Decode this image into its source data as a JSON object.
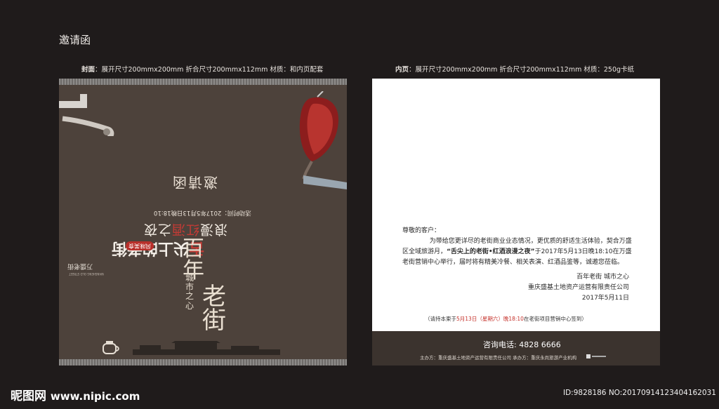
{
  "page_title": "邀请函",
  "cover_spec": {
    "label": "封面",
    "text": "：展开尺寸200mmx200mm 折合尺寸200mmx112mm 材质：和内页配套"
  },
  "inner_spec": {
    "label": "内页",
    "text": "：展开尺寸200mmx200mm 折合尺寸200mmx112mm 材质：250g卡纸"
  },
  "cover": {
    "title": "邀请函",
    "event_date": "活动时间：2017年5月13日晚18:10",
    "event_name_prefix": "浪漫",
    "event_name_red": "红酒",
    "event_name_suffix": "之夜",
    "headline_red": "舌",
    "headline_rest": "尖上的老街",
    "badge": "风味美食",
    "brand": "万盛老街",
    "brand_sub": "WANSHENG OLD STREET",
    "calligraphy_a": "百年",
    "calligraphy_b": "老街",
    "calligraphy_small": "城市之心"
  },
  "inner": {
    "salutation": "尊敬的客户：",
    "body_before": "为带给您更详尽的老街商业业态情况，更优质的舒适生活体验，契合万盛区全域旅游月，",
    "body_highlight": "“舌尖上的老街•红酒浪漫之夜”",
    "body_after": "于2017年5月13日晚18:10在万盛老街营销中心举行，届时将有精美冷餐、相关表演、红酒品鉴等，诚邀您莅临。",
    "sign_slogan": "百年老街  城市之心",
    "sign_company": "重庆盛基土地资产运营有限责任公司",
    "sign_date": "2017年5月11日",
    "note_prefix": "（请持本柬于",
    "note_red": "5月13日（星期六）晚18:10",
    "note_suffix": "在老街项目营销中心签到）",
    "hotline_label": "咨询电话:",
    "hotline_number": "4828 6666",
    "credits": "主办方：重庆盛基土地资产运营有限责任公司     承办方：重庆永尚旅游产业机构"
  },
  "watermark": {
    "site": "昵图网",
    "url": "www.nipic.com",
    "id_text": "ID:9828186 NO:20170914123404162031"
  }
}
